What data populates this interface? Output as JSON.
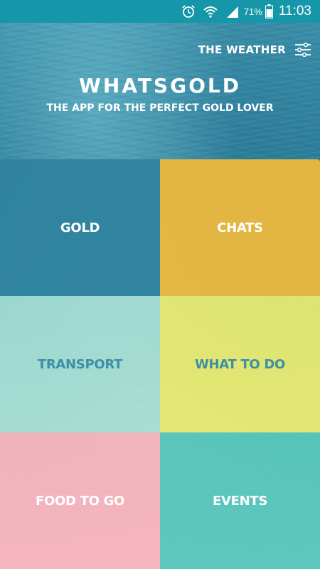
{
  "status_bar": {
    "battery_pct": "71%",
    "time": "11:03",
    "icons": [
      "alarm-icon",
      "wifi-icon",
      "signal-icon",
      "battery-icon"
    ]
  },
  "header": {
    "weather_label": "THE WEATHER",
    "settings_icon": "sliders-icon",
    "title": "WHATSGOLD",
    "subtitle": "THE APP FOR THE PERFECT GOLD LOVER"
  },
  "tiles": [
    {
      "label": "GOLD",
      "color": "#2e829e"
    },
    {
      "label": "CHATS",
      "color": "#eab840"
    },
    {
      "label": "TRANSPORT",
      "color": "#aae1d4"
    },
    {
      "label": "WHAT TO DO",
      "color": "#eaea6e"
    },
    {
      "label": "FOOD TO GO",
      "color": "#f8b2bc"
    },
    {
      "label": "EVENTS",
      "color": "#52c4ba"
    }
  ],
  "colors": {
    "status_bar": "#1596a9",
    "dark_tile_text": "#3c8fa6"
  }
}
